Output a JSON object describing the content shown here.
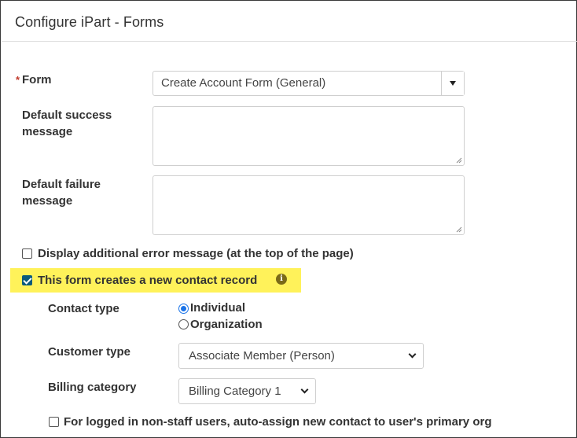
{
  "header": {
    "title": "Configure iPart - Forms"
  },
  "form_field": {
    "required_mark": "*",
    "label": "Form",
    "selected_value": "Create Account Form (General)"
  },
  "success_message": {
    "label_line1": "Default success",
    "label_line2": "message",
    "value": ""
  },
  "failure_message": {
    "label_line1": "Default failure",
    "label_line2": "message",
    "value": ""
  },
  "display_error": {
    "label": "Display additional error message (at the top of the page)",
    "checked": false
  },
  "creates_contact": {
    "label": "This form creates a new contact record",
    "checked": true,
    "info_icon": "info-icon",
    "highlight_color": "#fff25a"
  },
  "contact_type": {
    "label": "Contact type",
    "options": [
      "Individual",
      "Organization"
    ],
    "selected": "Individual"
  },
  "customer_type": {
    "label": "Customer type",
    "selected_value": "Associate Member (Person)"
  },
  "billing_category": {
    "label": "Billing category",
    "selected_value": "Billing Category 1"
  },
  "auto_assign": {
    "label": "For logged in non-staff users, auto-assign new contact to user's primary org",
    "checked": false
  }
}
